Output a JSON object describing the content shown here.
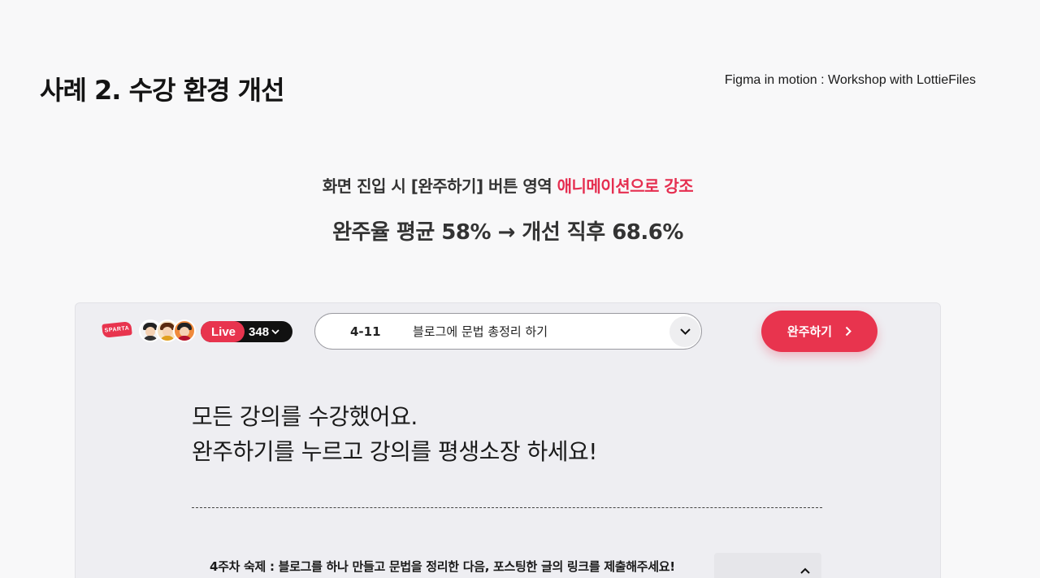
{
  "slide": {
    "title": "사례 2. 수강 환경 개선",
    "source": "Figma in motion : Workshop with LottieFiles",
    "headline_prefix": "화면 진입 시 [완주하기] 버튼 영역 ",
    "headline_accent": "애니메이션으로 강조",
    "stat": "완주율 평균 58% → 개선 직후 68.6%"
  },
  "colors": {
    "accent": "#e8344e",
    "accent_text": "#e52e50",
    "panel_bg": "#eeeef2"
  },
  "player": {
    "logo_text": "SPARTA",
    "live_label": "Live",
    "viewer_count": "348",
    "lesson": {
      "number": "4-11",
      "title": "블로그에 문법 총정리 하기"
    },
    "complete_button": "완주하기",
    "message_line1": "모든 강의를 수강했어요.",
    "message_line2": "완주하기를 누르고 강의를 평생소장 하세요!",
    "homework": "4주차 숙제 : 블로그를 하나 만들고 문법을 정리한 다음, 포스팅한 글의 링크를 제출해주세요!"
  },
  "icons": {
    "viewer_dropdown": "chevron-down-icon",
    "lesson_dropdown": "chevron-down-icon",
    "complete_arrow": "chevron-right-icon",
    "homework_toggle": "chevron-up-icon"
  }
}
